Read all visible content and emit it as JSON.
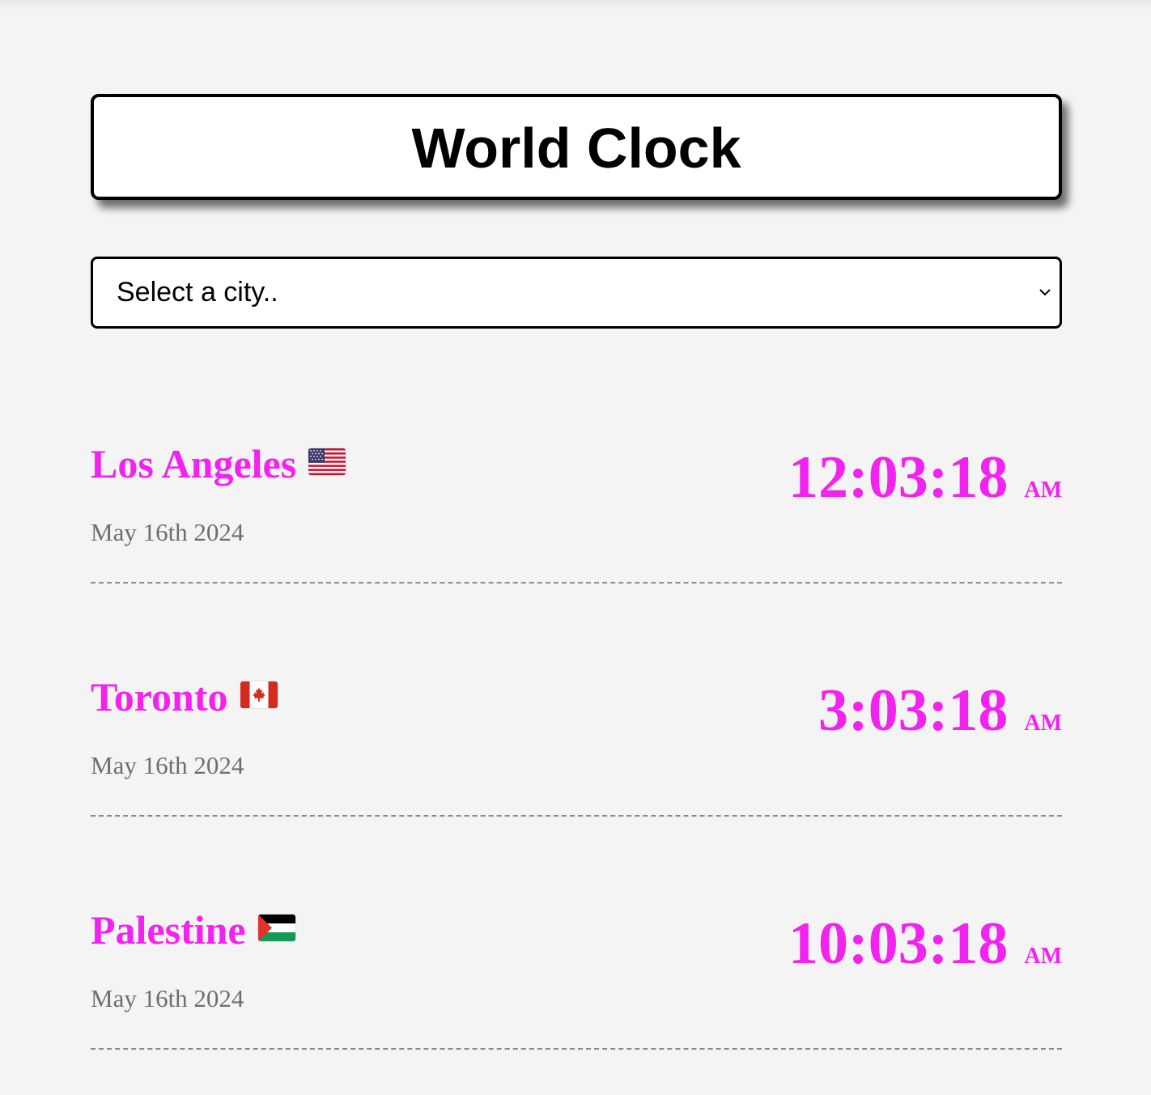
{
  "header": {
    "title": "World Clock"
  },
  "city_select": {
    "value": "Select a city.."
  },
  "colors": {
    "accent": "#f222ef",
    "date_text": "#6e6e6e",
    "background": "#f4f4f4"
  },
  "cities": [
    {
      "name": "Los Angeles",
      "flag": "us-flag-icon",
      "date": "May 16th 2024",
      "time": "12:03:18",
      "ampm": "AM"
    },
    {
      "name": "Toronto",
      "flag": "canada-flag-icon",
      "date": "May 16th 2024",
      "time": "3:03:18",
      "ampm": "AM"
    },
    {
      "name": "Palestine",
      "flag": "palestine-flag-icon",
      "date": "May 16th 2024",
      "time": "10:03:18",
      "ampm": "AM"
    }
  ]
}
